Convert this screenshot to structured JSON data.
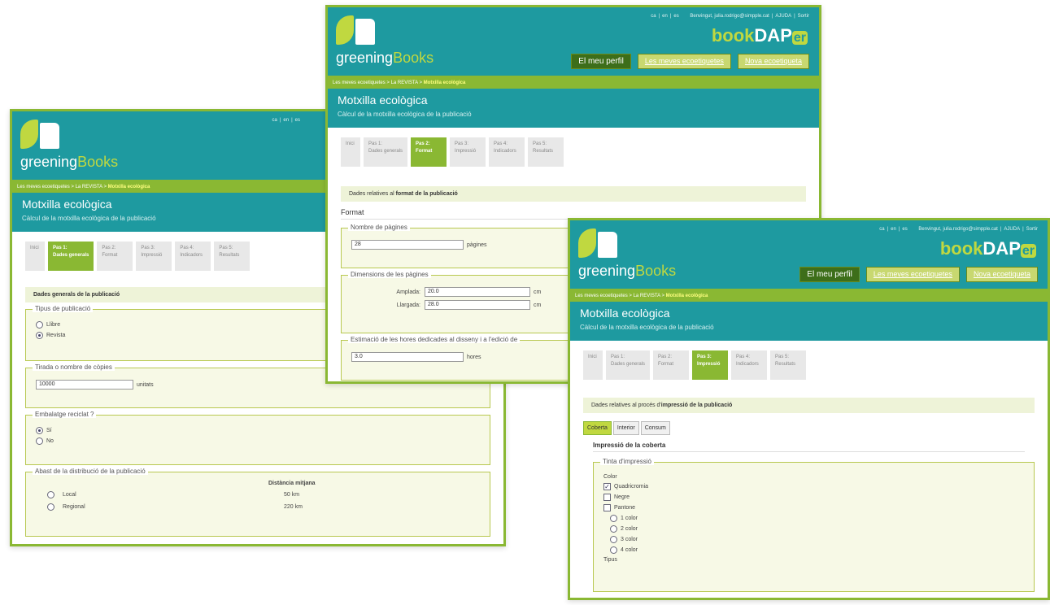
{
  "common": {
    "lang_links": [
      "ca",
      "en",
      "es"
    ],
    "welcome": "Benvingut, julia.rodrigo@simpple.cat",
    "user_links": [
      "AJUDA",
      "Sortir"
    ],
    "logo_word1": "greening",
    "logo_word2": "Books",
    "app_prefix": "book",
    "app_main": "DAP",
    "app_suffix": "er",
    "nav_profile": "El meu perfil",
    "nav_my_calcs": "Les meves ecoetiquetes",
    "nav_new_calc": "Nova ecoetiqueta",
    "crumb_1": "Les meves ecoetiquetes",
    "crumb_2": "La REVISTA",
    "crumb_current": "Motxilla ecològica",
    "page_title": "Motxilla ecològica",
    "page_subtitle": "Càlcul de la motxilla ecològica de la publicació",
    "steps": [
      {
        "l1": "Inici",
        "l2": ""
      },
      {
        "l1": "Pas 1:",
        "l2": "Dades generals"
      },
      {
        "l1": "Pas 2:",
        "l2": "Format"
      },
      {
        "l1": "Pas 3:",
        "l2": "Impressió"
      },
      {
        "l1": "Pas 4:",
        "l2": "Indicadors"
      },
      {
        "l1": "Pas 5:",
        "l2": "Resultats"
      }
    ]
  },
  "win1": {
    "info": "Dades generals de la publicació",
    "tipus_legend": "Tipus de publicació",
    "tipus_opt1": "Llibre",
    "tipus_opt2": "Revista",
    "tirada_legend": "Tirada o nombre de còpies",
    "tirada_value": "10000",
    "tirada_unit": "unitats",
    "embalatge_legend": "Embalatge reciclat ?",
    "emb_yes": "Sí",
    "emb_no": "No",
    "abast_legend": "Abast de la distribució de la publicació",
    "dist_header": "Distància mitjana",
    "dist_rows": [
      {
        "label": "Local",
        "value": "50 km"
      },
      {
        "label": "Regional",
        "value": "220 km"
      }
    ]
  },
  "win2": {
    "info_pre": "Dades relatives al ",
    "info_bold": "format de la publicació",
    "section": "Format",
    "pages_legend": "Nombre de pàgines",
    "pages_value": "28",
    "pages_unit": "pàgines",
    "dims_legend": "Dimensions de les pàgines",
    "width_label": "Amplada:",
    "width_value": "20.0",
    "height_label": "Llargada:",
    "height_value": "28.0",
    "dims_unit": "cm",
    "hours_legend": "Estimació de les hores dedicades al disseny i a l'edició de",
    "hours_value": "3.0",
    "hours_unit": "hores"
  },
  "win3": {
    "info_pre": "Dades relatives al procés d'",
    "info_bold": "impressió de la publicació",
    "tab1": "Coberta",
    "tab2": "Interior",
    "tab3": "Consum",
    "sub_heading": "Impressió de la coberta",
    "tinta_legend": "Tinta d'impressió",
    "color_label": "Color",
    "colors": [
      {
        "label": "Quadricromia",
        "checked": true
      },
      {
        "label": "Negre",
        "checked": false
      },
      {
        "label": "Pantone",
        "checked": false
      }
    ],
    "pantone_opts": [
      "1 color",
      "2 color",
      "3 color",
      "4 color"
    ],
    "tipus_label": "Tipus"
  }
}
